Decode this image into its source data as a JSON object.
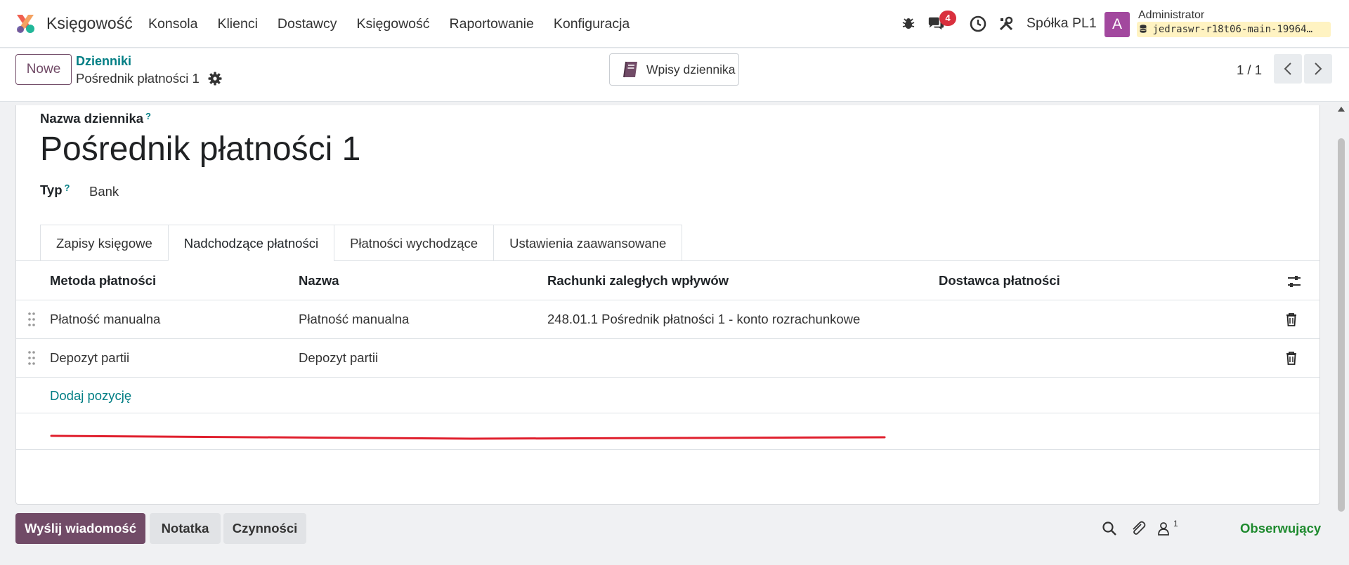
{
  "navbar": {
    "app_name": "Księgowość",
    "menu": [
      "Konsola",
      "Klienci",
      "Dostawcy",
      "Księgowość",
      "Raportowanie",
      "Konfiguracja"
    ],
    "messages_badge": "4",
    "company": "Spółka PL1",
    "avatar_letter": "A",
    "user": "Administrator",
    "database": "jedraswr-r18t06-main-19964…"
  },
  "control_panel": {
    "new_button": "Nowe",
    "breadcrumb_parent": "Dzienniki",
    "breadcrumb_current": "Pośrednik płatności 1",
    "smart_button": "Wpisy dziennika",
    "pager": "1 / 1"
  },
  "form": {
    "name_label": "Nazwa dziennika",
    "help_mark": "?",
    "name_value": "Pośrednik płatności 1",
    "type_label": "Typ",
    "type_value": "Bank",
    "tabs": [
      "Zapisy księgowe",
      "Nadchodzące płatności",
      "Płatności wychodzące",
      "Ustawienia zaawansowane"
    ],
    "active_tab": "Nadchodzące płatności",
    "columns": [
      "Metoda płatności",
      "Nazwa",
      "Rachunki zaległych wpływów",
      "Dostawca płatności"
    ],
    "rows": [
      {
        "method": "Płatność manualna",
        "name": "Płatność manualna",
        "account": "248.01.1 Pośrednik płatności 1 - konto rozrachunkowe",
        "provider": ""
      },
      {
        "method": "Depozyt partii",
        "name": "Depozyt partii",
        "account": "",
        "provider": ""
      }
    ],
    "add_line": "Dodaj pozycję"
  },
  "chatter": {
    "send_message": "Wyślij wiadomość",
    "note": "Notatka",
    "activities": "Czynności",
    "followers_count": "1",
    "follow": "Obserwujący"
  },
  "colors": {
    "brand": "#714b67",
    "link": "#017e84",
    "badge": "#d9303e",
    "avatar": "#a2489e",
    "annotation": "#e0202e",
    "follow": "#1e8a2e"
  }
}
